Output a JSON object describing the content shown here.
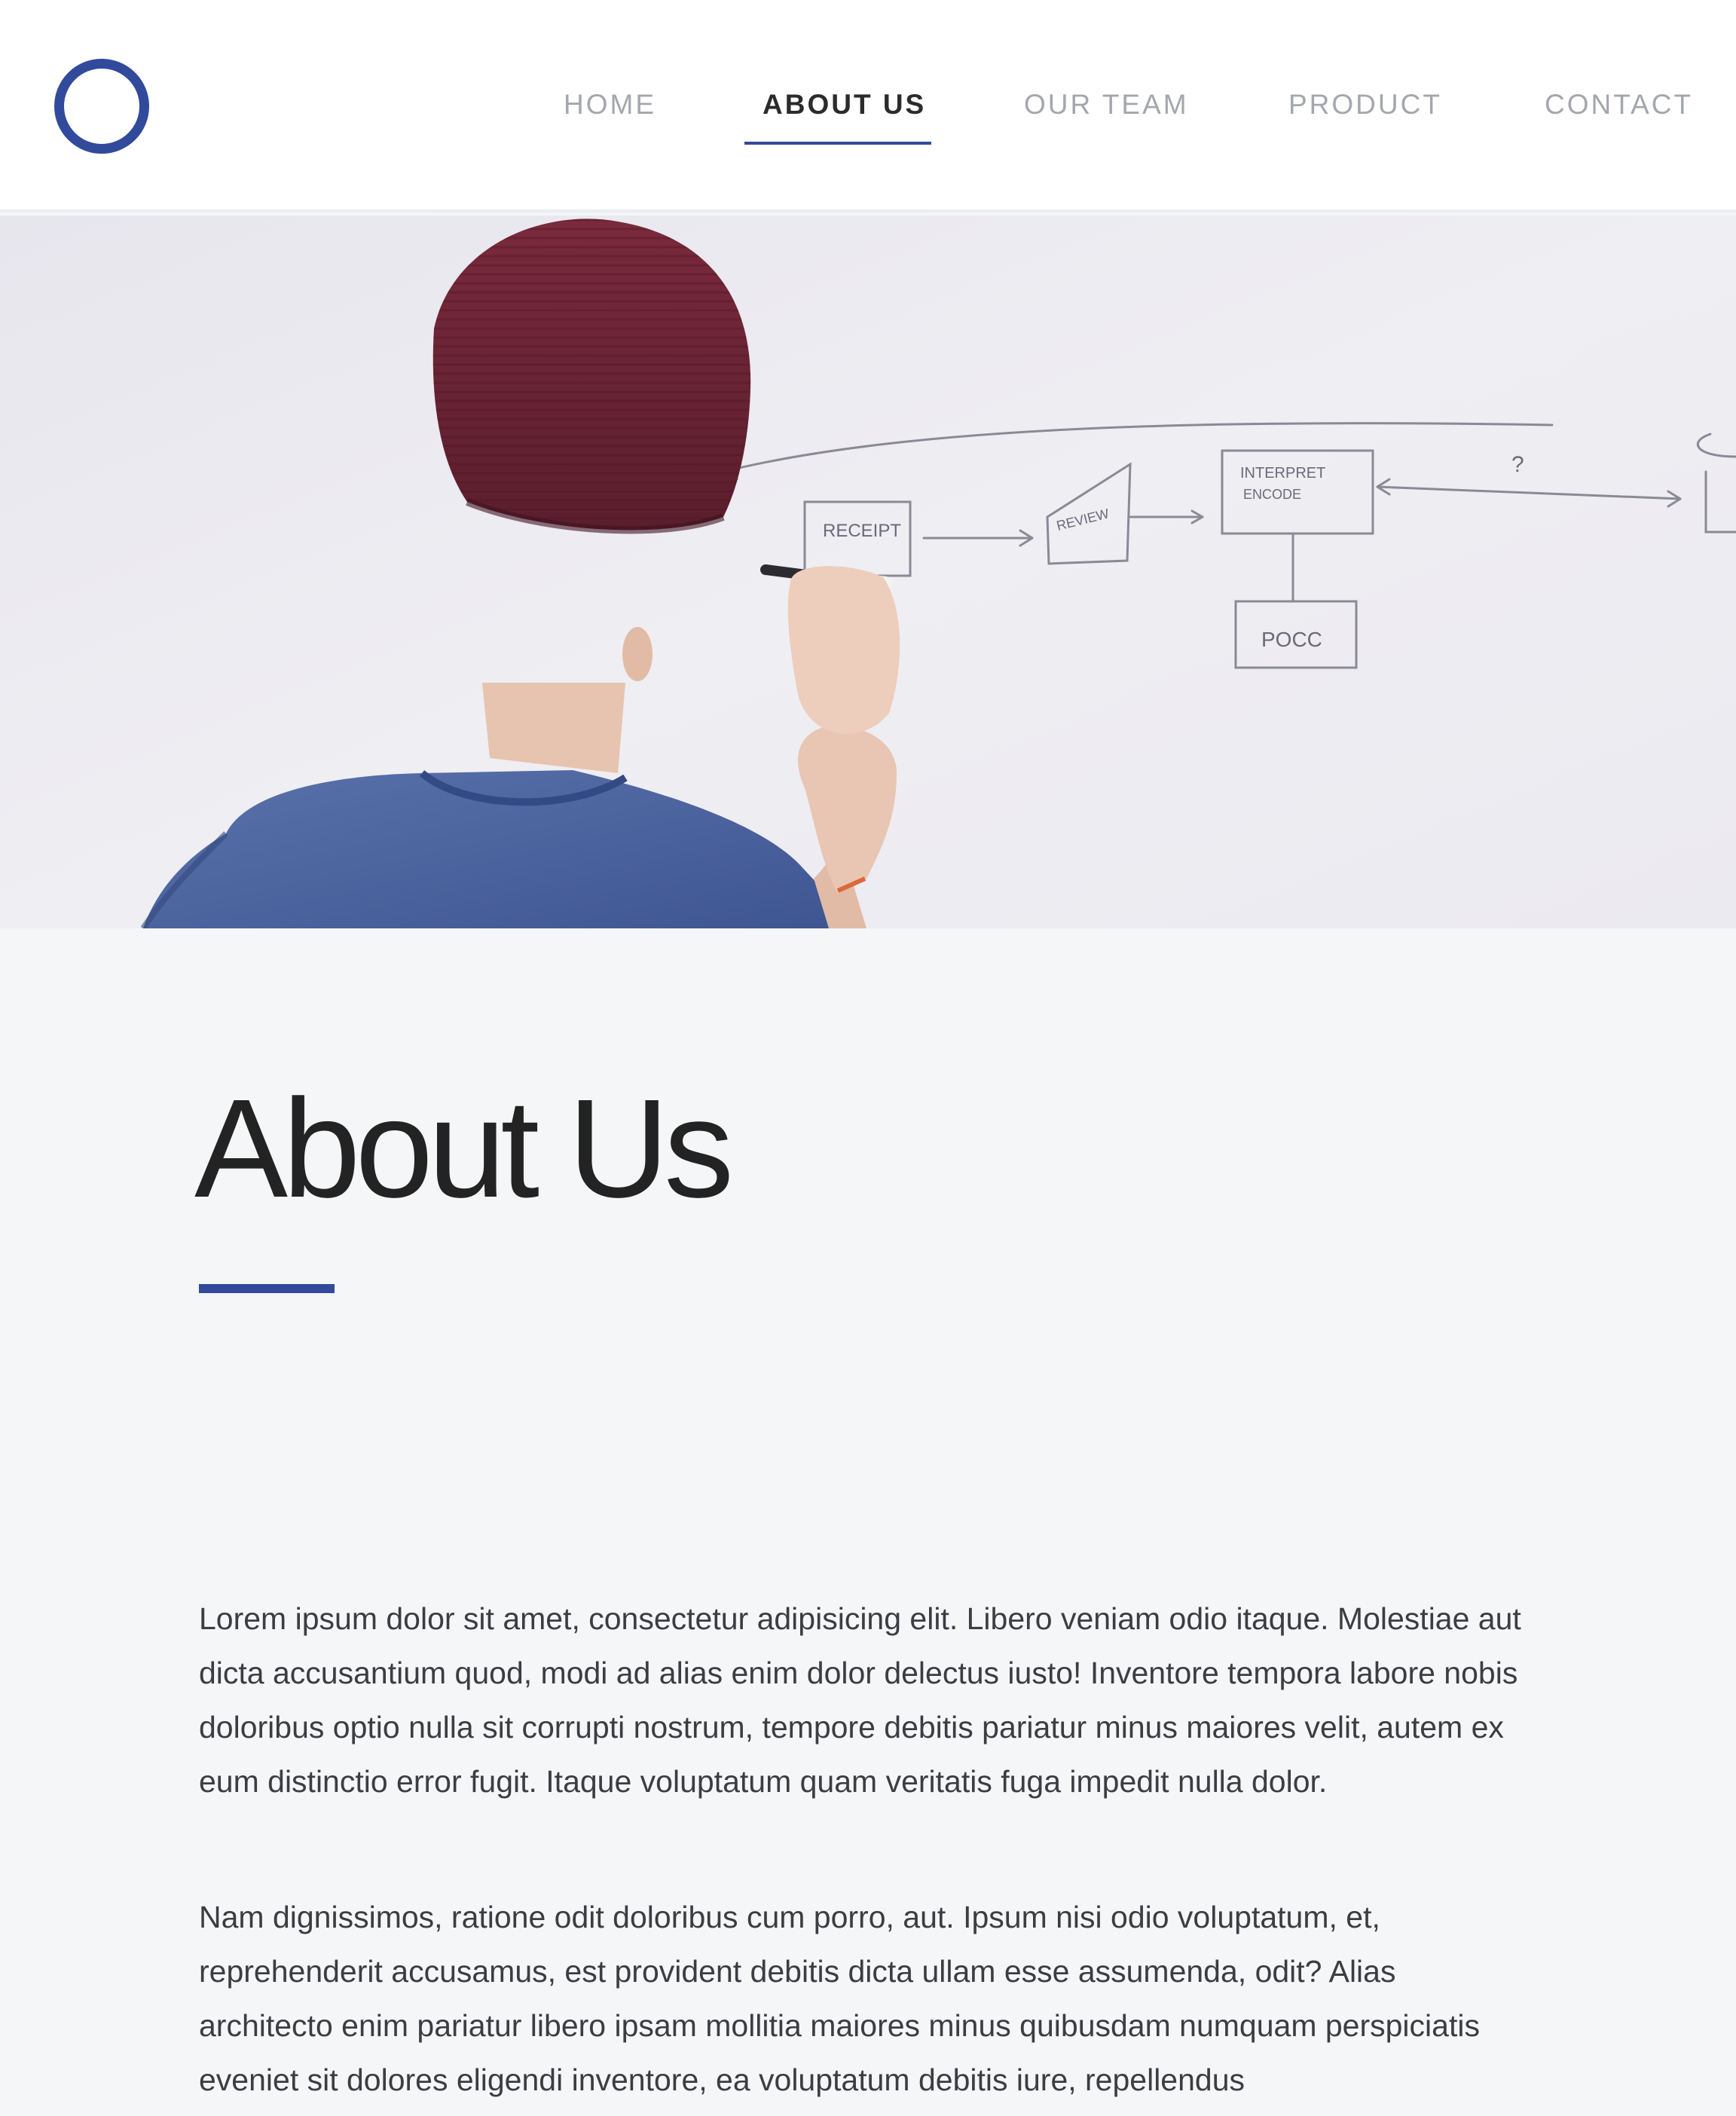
{
  "header": {
    "logo": "circle-logo",
    "nav": [
      {
        "label": "HOME",
        "active": false
      },
      {
        "label": "ABOUT US",
        "active": true
      },
      {
        "label": "OUR TEAM",
        "active": false
      },
      {
        "label": "PRODUCT",
        "active": false
      },
      {
        "label": "CONTACT",
        "active": false
      }
    ]
  },
  "hero": {
    "whiteboard_labels": [
      "RECEIPT",
      "REVIEW",
      "INTERPRET",
      "ENCODE",
      "POCC",
      "?"
    ]
  },
  "main": {
    "title": "About Us",
    "paragraphs": [
      "Lorem ipsum dolor sit amet, consectetur adipisicing elit. Libero veniam odio itaque. Molestiae aut dicta accusantium quod, modi ad alias enim dolor delectus iusto! Inventore tempora labore nobis doloribus optio nulla sit corrupti nostrum, tempore debitis pariatur minus maiores velit, autem ex eum distinctio error fugit. Itaque voluptatum quam veritatis fuga impedit nulla dolor.",
      "Nam dignissimos, ratione odit doloribus cum porro, aut. Ipsum nisi odio voluptatum, et, reprehenderit accusamus, est provident debitis dicta ullam esse assumenda, odit? Alias architecto enim pariatur libero ipsam mollitia maiores minus quibusdam numquam perspiciatis eveniet sit dolores eligendi inventore, ea voluptatum debitis iure, repellendus"
    ]
  },
  "colors": {
    "accent": "#324a9c",
    "background": "#f5f6f8",
    "heading": "#232323",
    "nav_inactive": "#a3a7ad"
  }
}
